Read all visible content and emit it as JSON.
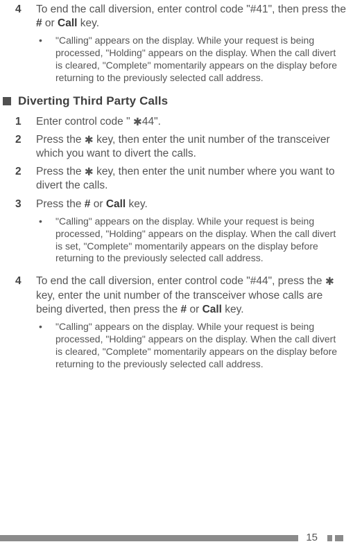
{
  "topBlock": {
    "step4": {
      "num": "4",
      "text_a": "To end the call diversion, enter control code \"#41\", then press the ",
      "text_hash": "#",
      "text_or": " or ",
      "text_call": "Call",
      "text_end": " key."
    },
    "bullet4": "\"Calling\" appears on the display.  While your request is being processed, \"Holding\" appears on the display.   When the call divert is cleared, \"Complete\" momentarily appears on the display before returning to the previously selected call address."
  },
  "section": {
    "title": "Diverting Third Party Calls"
  },
  "steps": {
    "s1": {
      "num": "1",
      "text_a": "Enter control code \" ",
      "star": "✱",
      "text_b": "44\"."
    },
    "s2a": {
      "num": "2",
      "text_a": "Press the ",
      "star": "✱",
      "text_b": " key, then enter the unit number of the transceiver which you want to divert the calls."
    },
    "s2b": {
      "num": "2",
      "text_a": "Press the ",
      "star": "✱",
      "text_b": " key, then enter the unit number where you want to divert the calls."
    },
    "s3": {
      "num": "3",
      "text_a": "Press the ",
      "hash": "#",
      "or": " or ",
      "call": "Call",
      "end": " key."
    },
    "bullet3": "\"Calling\" appears on the display.  While your request is being processed, \"Holding\" appears on the display.   When the call divert is set, \"Complete\" momentarily appears on the display before returning to the previously selected call address.",
    "s4": {
      "num": "4",
      "text_a": "To end the call diversion, enter control code \"#44\", press the ",
      "star": "✱",
      "text_b": " key, enter the unit number of the transceiver whose calls are being diverted, then press the ",
      "hash": "#",
      "or": " or ",
      "call": "Call",
      "end": " key."
    },
    "bullet4b": "\"Calling\" appears on the display.  While your request is being processed, \"Holding\" appears on the display.   When the call divert is cleared, \"Complete\" momentarily appears on the display before returning to the previously selected call address."
  },
  "bulletMark": "•",
  "pageNumber": "15"
}
